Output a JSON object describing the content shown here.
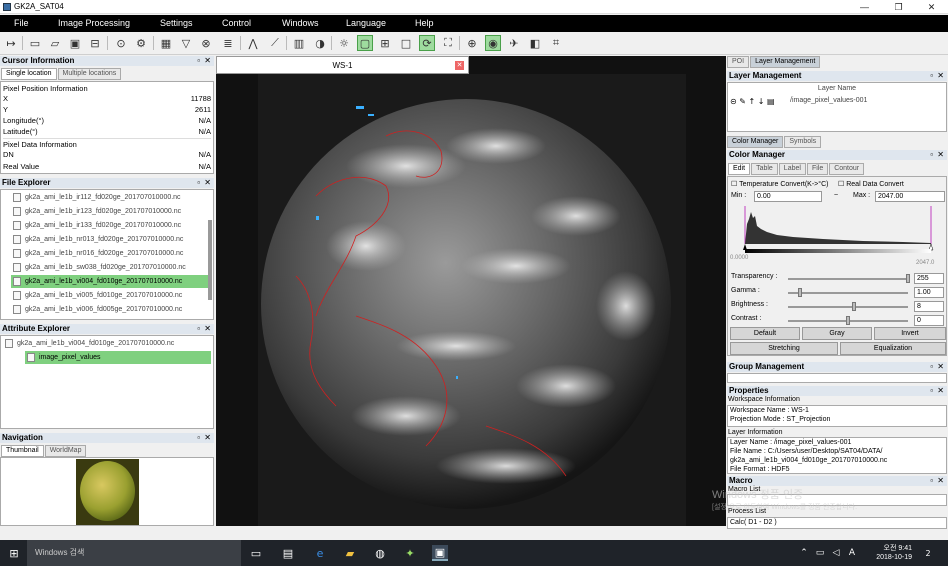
{
  "window": {
    "title": "GK2A_SAT04",
    "min": "—",
    "max": "❐",
    "close": "✕"
  },
  "menu": [
    "File",
    "Image Processing",
    "Settings",
    "Control",
    "Windows",
    "Language",
    "Help"
  ],
  "cursor_info": {
    "title": "Cursor Information",
    "tabs": [
      "Single location",
      "Multiple locations"
    ],
    "pixel_position_header": "Pixel Position Information",
    "rows": [
      {
        "label": "X",
        "value": "11788"
      },
      {
        "label": "Y",
        "value": "2611"
      },
      {
        "label": "Longitude(°)",
        "value": "N/A"
      },
      {
        "label": "Latitude(°)",
        "value": "N/A"
      }
    ],
    "pixel_data_header": "Pixel Data Information",
    "data_rows": [
      {
        "label": "DN",
        "value": "N/A"
      },
      {
        "label": "Real Value",
        "value": "N/A"
      }
    ]
  },
  "file_explorer": {
    "title": "File Explorer",
    "files": [
      "gk2a_ami_le1b_ir112_fd020ge_201707010000.nc",
      "gk2a_ami_le1b_ir123_fd020ge_201707010000.nc",
      "gk2a_ami_le1b_ir133_fd020ge_201707010000.nc",
      "gk2a_ami_le1b_nr013_fd020ge_201707010000.nc",
      "gk2a_ami_le1b_nr016_fd020ge_201707010000.nc",
      "gk2a_ami_le1b_sw038_fd020ge_201707010000.nc",
      "gk2a_ami_le1b_vi004_fd010ge_201707010000.nc",
      "gk2a_ami_le1b_vi005_fd010ge_201707010000.nc",
      "gk2a_ami_le1b_vi006_fd005ge_201707010000.nc"
    ],
    "selected_index": 6
  },
  "attribute_explorer": {
    "title": "Attribute Explorer",
    "root": "gk2a_ami_le1b_vi004_fd010ge_201707010000.nc",
    "child": "image_pixel_values"
  },
  "navigation": {
    "title": "Navigation",
    "tabs": [
      "Thumbnail",
      "WorldMap"
    ]
  },
  "workspace": {
    "tab": "WS-1",
    "close": "✕"
  },
  "right": {
    "top_tabs": [
      "POI",
      "Layer Management"
    ],
    "layer_title": "Layer Management",
    "layer_col": "Layer Name",
    "layer_row": "/image_pixel_values-001",
    "mid_tabs": [
      "Color Manager",
      "Symbols"
    ],
    "color_title": "Color Manager",
    "color_tabs": [
      "Edit",
      "Table",
      "Label",
      "File",
      "Contour"
    ],
    "temp_convert": "Temperature Convert(K->°C)",
    "real_convert": "Real Data Convert",
    "min_label": "Min :",
    "min_value": "0.00",
    "tilde": "~",
    "max_label": "Max :",
    "max_value": "2047.00",
    "hist_min": "0.0000",
    "hist_max": "2047.0",
    "sliders": [
      {
        "label": "Transparency :",
        "value": "255",
        "level": 1.0
      },
      {
        "label": "Gamma :",
        "value": "1.00",
        "level": 0.1
      },
      {
        "label": "Brightness :",
        "value": "8",
        "level": 0.55
      },
      {
        "label": "Contrast :",
        "value": "0",
        "level": 0.5
      }
    ],
    "buttons": [
      "Default",
      "Gray",
      "Invert"
    ],
    "buttons2": [
      "Stretching",
      "Equalization"
    ],
    "group_title": "Group Management",
    "properties_title": "Properties",
    "ws_info_header": "Workspace Information",
    "ws_info": [
      "Workspace Name : WS-1",
      "Projection Mode : ST_Projection"
    ],
    "layer_info_header": "Layer Information",
    "layer_info": [
      "Layer Name : /image_pixel_values-001",
      "File Name : C:/Users/user/Desktop/SAT04/DATA/",
      "gk2a_ami_le1b_vi004_fd010ge_201707010000.nc",
      "File Format : HDF5"
    ],
    "macro_title": "Macro",
    "macro_list": "Macro List",
    "process_list": "Process List",
    "process_item": "Calc( D1 - D2 )"
  },
  "watermark": {
    "line1": "Windows 정품 인증",
    "line2": "[설정]으로 이동하여 Windows를 정품 인증합니다."
  },
  "taskbar": {
    "search": "Windows 검색",
    "time": "오전 9:41",
    "date": "2018-10-19",
    "lang": "A",
    "notif": "2"
  }
}
